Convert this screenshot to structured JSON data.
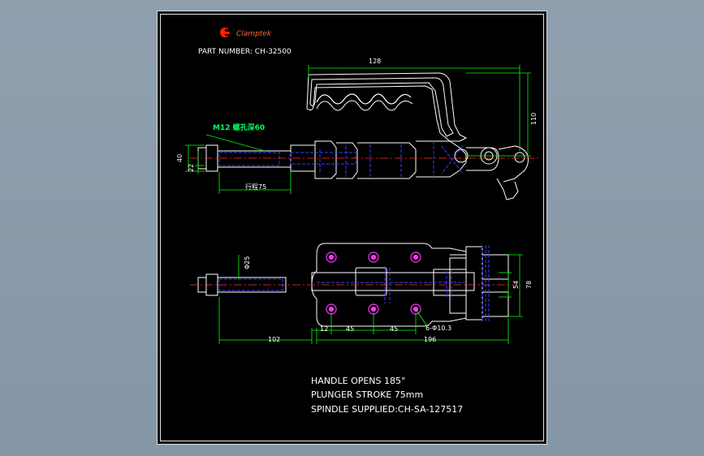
{
  "brand": {
    "logo_text": "Clamptek"
  },
  "part_number": "PART NUMBER:  CH-32500",
  "dims": {
    "handle_length": "128",
    "handle_height": "110",
    "height_40": "40",
    "height_22": "22",
    "stroke_cn": "行程75",
    "thread_cn": "M12 螺孔深60",
    "dia_25": "Φ25",
    "len_102": "102",
    "len_12": "12",
    "len_45a": "45",
    "len_45b": "45",
    "holes": "6-Φ10.3",
    "len_196": "196",
    "height_54": "54",
    "height_78": "78"
  },
  "notes": [
    "HANDLE OPENS 185°",
    "PLUNGER STROKE   75mm",
    "SPINDLE SUPPLIED:CH-SA-127517"
  ],
  "colors": {
    "outline": "#ffffff",
    "dimension": "#00ff00",
    "hidden": "#3b3bff",
    "holes": "#ff33ff",
    "center": "#ff3333",
    "logo": "#ff2200"
  }
}
